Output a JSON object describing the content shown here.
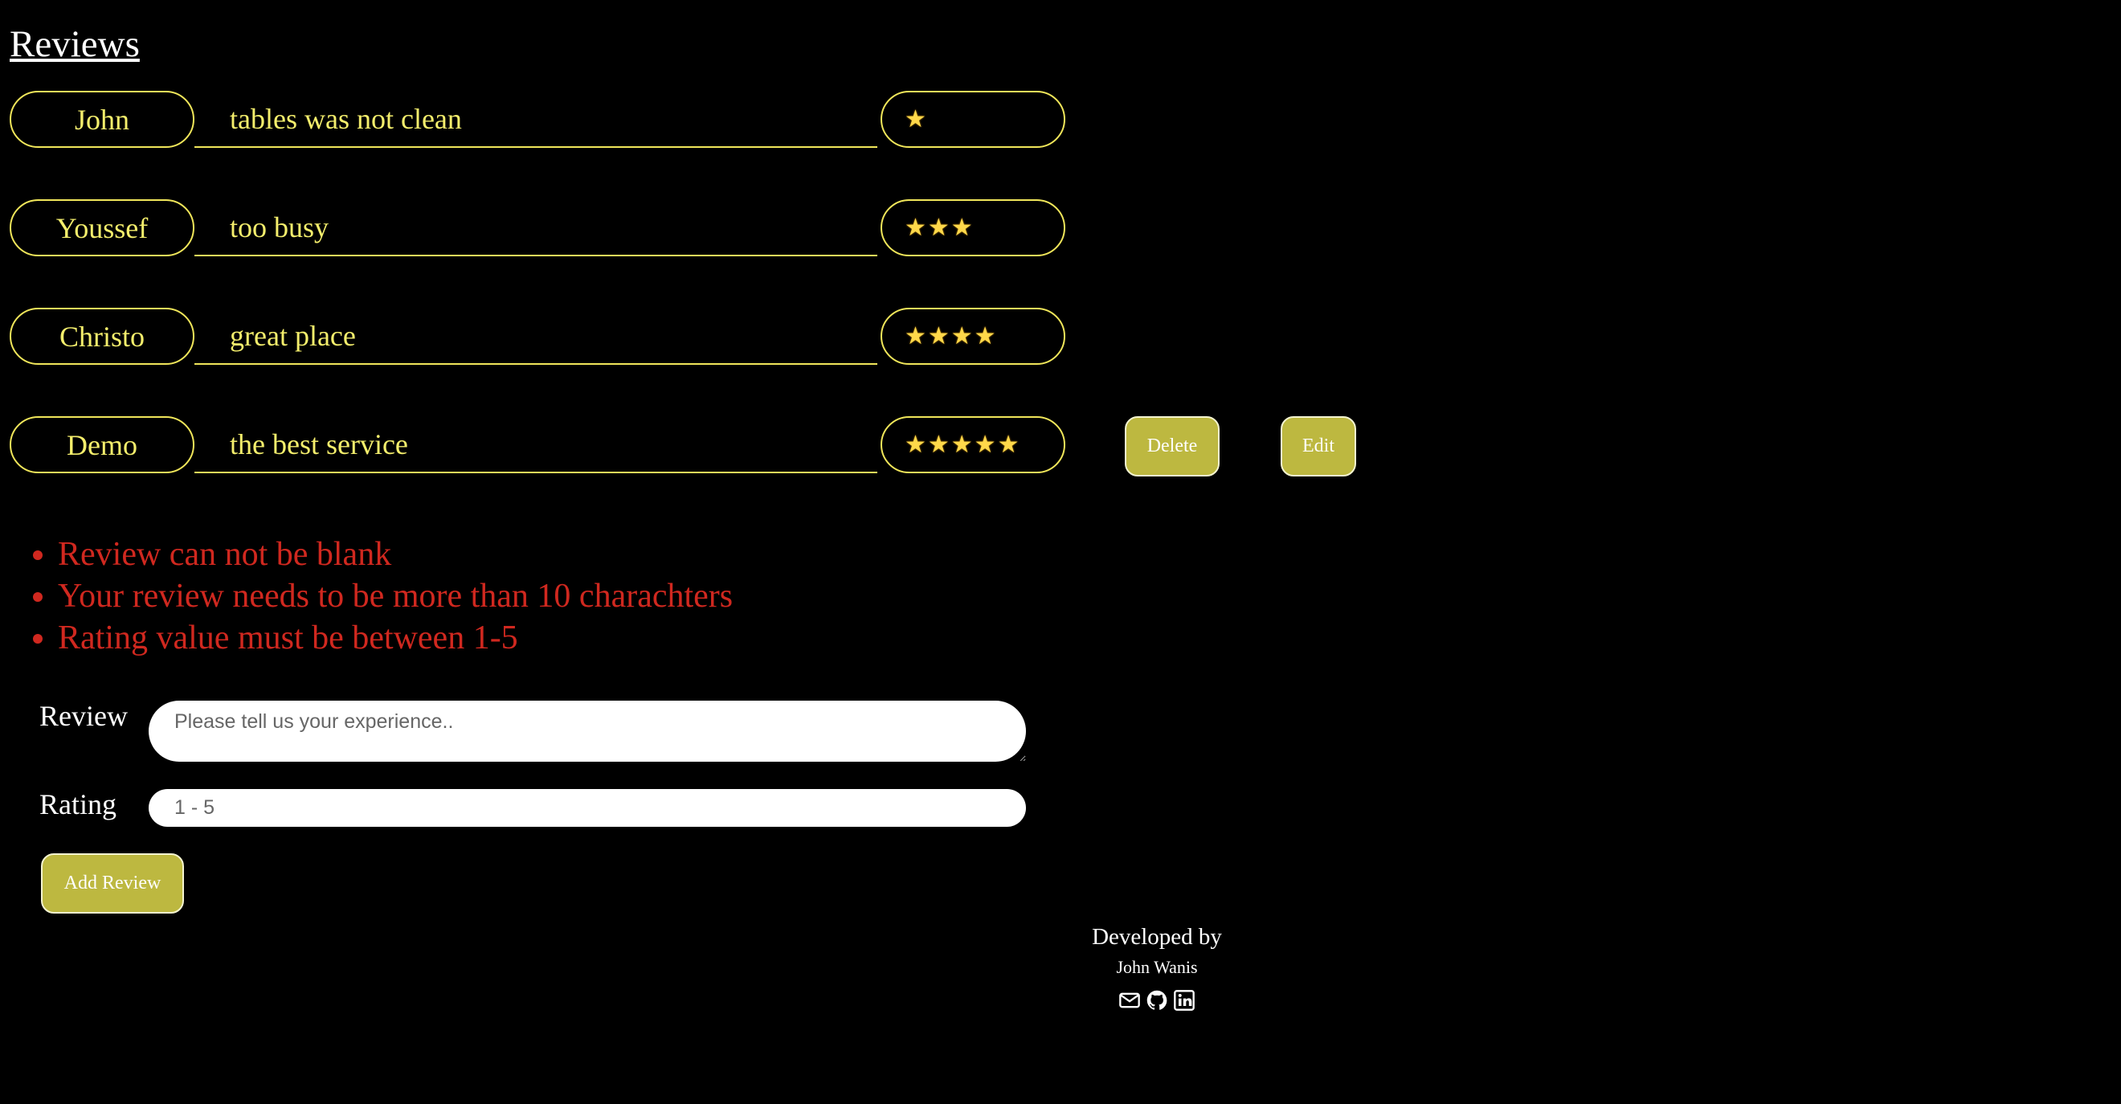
{
  "page": {
    "title": "Reviews"
  },
  "reviews": [
    {
      "name": "John",
      "text": "tables was not clean",
      "rating": 1,
      "stars": "★"
    },
    {
      "name": "Youssef",
      "text": "too busy",
      "rating": 3,
      "stars": "★★★"
    },
    {
      "name": "Christo",
      "text": "great place",
      "rating": 4,
      "stars": "★★★★"
    },
    {
      "name": "Demo",
      "text": "the best service",
      "rating": 5,
      "stars": "★★★★★"
    }
  ],
  "actions": {
    "delete_label": "Delete",
    "edit_label": "Edit"
  },
  "errors": [
    "Review can not be blank",
    "Your review needs to be more than 10 charachters",
    "Rating value must be between 1-5"
  ],
  "form": {
    "review_label": "Review",
    "review_placeholder": "Please tell us your experience..",
    "rating_label": "Rating",
    "rating_placeholder": "1 - 5",
    "submit_label": "Add Review"
  },
  "footer": {
    "developed_by": "Developed by",
    "developer_name": "John Wanis",
    "icons": [
      "email-icon",
      "github-icon",
      "linkedin-icon"
    ]
  },
  "colors": {
    "background": "#000000",
    "accent_yellow": "#f4ee6c",
    "button_olive": "#bdb840",
    "error_red": "#d0281f"
  }
}
